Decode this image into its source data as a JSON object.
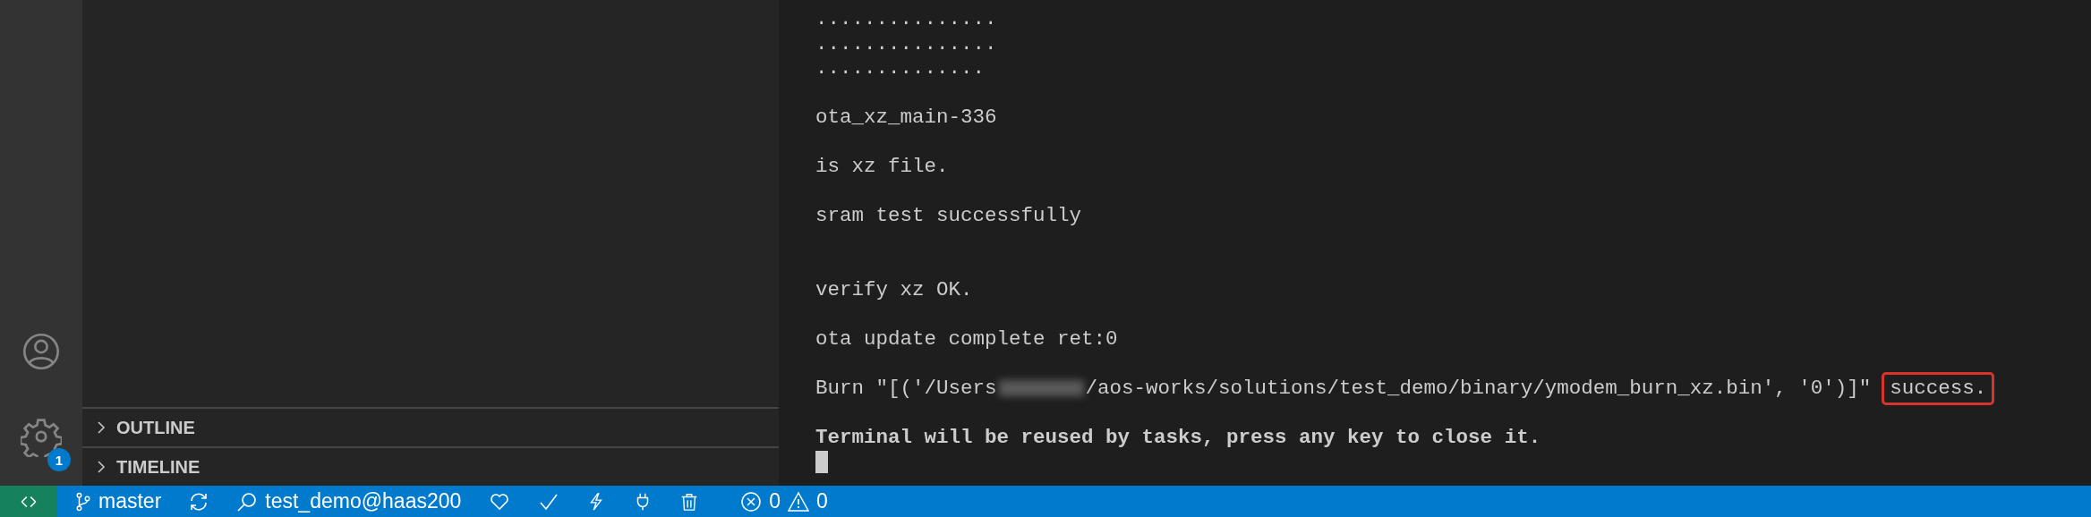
{
  "sidebar": {
    "sections": [
      {
        "title": "OUTLINE",
        "expanded": false
      },
      {
        "title": "TIMELINE",
        "expanded": false
      }
    ]
  },
  "activity_bar": {
    "settings_badge": "1"
  },
  "terminal": {
    "lines": [
      {
        "kind": "text",
        "text": "..............."
      },
      {
        "kind": "text",
        "text": "..............."
      },
      {
        "kind": "text",
        "text": ".............."
      },
      {
        "kind": "blank"
      },
      {
        "kind": "text",
        "text": "ota_xz_main-336"
      },
      {
        "kind": "blank"
      },
      {
        "kind": "text",
        "text": "is xz file."
      },
      {
        "kind": "blank"
      },
      {
        "kind": "text",
        "text": "sram test successfully"
      },
      {
        "kind": "blank"
      },
      {
        "kind": "blank"
      },
      {
        "kind": "text",
        "text": "verify xz OK."
      },
      {
        "kind": "blank"
      },
      {
        "kind": "text",
        "text": "ota update complete ret:0"
      },
      {
        "kind": "blank"
      },
      {
        "kind": "burn",
        "before": "Burn \"[('/Users",
        "after": "/aos-works/solutions/test_demo/binary/ymodem_burn_xz.bin', '0')]\"",
        "highlight": "success."
      },
      {
        "kind": "blank"
      },
      {
        "kind": "bold",
        "text": "Terminal will be reused by tasks, press any key to close it."
      },
      {
        "kind": "cursor"
      }
    ]
  },
  "status_bar": {
    "branch": "master",
    "target": "test_demo@haas200",
    "errors": "0",
    "warnings": "0"
  }
}
